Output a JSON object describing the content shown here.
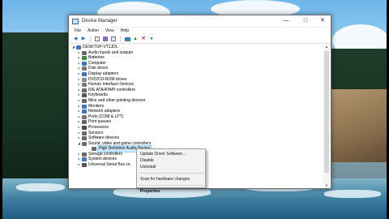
{
  "window": {
    "title": "Device Manager",
    "buttons": {
      "minimize": "—",
      "maximize": "□",
      "close": "✕"
    }
  },
  "menubar": [
    "File",
    "Action",
    "View",
    "Help"
  ],
  "toolbar": {
    "buttons": [
      "back-icon",
      "forward-icon",
      "properties-icon",
      "help-icon",
      "scan-icon",
      "monitor-icon",
      "update-driver-icon",
      "uninstall-icon",
      "disable-icon"
    ]
  },
  "tree": {
    "root": "DESKTOP-VT1JDL",
    "categories": [
      {
        "label": "Audio inputs and outputs",
        "icon_color": "#6a6a6a",
        "expanded": false
      },
      {
        "label": "Batteries",
        "icon_color": "#3c8c3c",
        "expanded": false
      },
      {
        "label": "Computer",
        "icon_color": "#3a78c2",
        "expanded": false
      },
      {
        "label": "Disk drives",
        "icon_color": "#777777",
        "expanded": false
      },
      {
        "label": "Display adapters",
        "icon_color": "#3a78c2",
        "expanded": false
      },
      {
        "label": "DVD/CD-ROM drives",
        "icon_color": "#888888",
        "expanded": false
      },
      {
        "label": "Human Interface Devices",
        "icon_color": "#7a7a7a",
        "expanded": false
      },
      {
        "label": "IDE ATA/ATAPI controllers",
        "icon_color": "#6c6c6c",
        "expanded": false
      },
      {
        "label": "Keyboards",
        "icon_color": "#555555",
        "expanded": false
      },
      {
        "label": "Mice and other pointing devices",
        "icon_color": "#666666",
        "expanded": false
      },
      {
        "label": "Monitors",
        "icon_color": "#3a78c2",
        "expanded": false
      },
      {
        "label": "Network adapters",
        "icon_color": "#3a78c2",
        "expanded": false
      },
      {
        "label": "Ports (COM & LPT)",
        "icon_color": "#777777",
        "expanded": false
      },
      {
        "label": "Print queues",
        "icon_color": "#666666",
        "expanded": false
      },
      {
        "label": "Processors",
        "icon_color": "#4a4a4a",
        "expanded": false
      },
      {
        "label": "Sensors",
        "icon_color": "#6a6a6a",
        "expanded": false
      },
      {
        "label": "Software devices",
        "icon_color": "#6a6a6a",
        "expanded": false
      },
      {
        "label": "Sound, video and game controllers",
        "icon_color": "#6a6a6a",
        "expanded": true
      },
      {
        "label": "High Definition Audio Device",
        "icon_color": "#6a6a6a",
        "child": true,
        "selected": true
      },
      {
        "label": "Storage controllers",
        "icon_color": "#6a6a6a",
        "expanded": false
      },
      {
        "label": "System devices",
        "icon_color": "#3a78c2",
        "expanded": false
      },
      {
        "label": "Universal Serial Bus co",
        "icon_color": "#555555",
        "expanded": false
      }
    ]
  },
  "context_menu": {
    "items": [
      {
        "label": "Update Driver Software...",
        "bold": false
      },
      {
        "label": "Disable",
        "bold": false
      },
      {
        "label": "Uninstall",
        "bold": false
      },
      {
        "separator": true
      },
      {
        "label": "Scan for hardware changes",
        "bold": false
      },
      {
        "separator": true
      },
      {
        "label": "Properties",
        "bold": true
      }
    ]
  }
}
